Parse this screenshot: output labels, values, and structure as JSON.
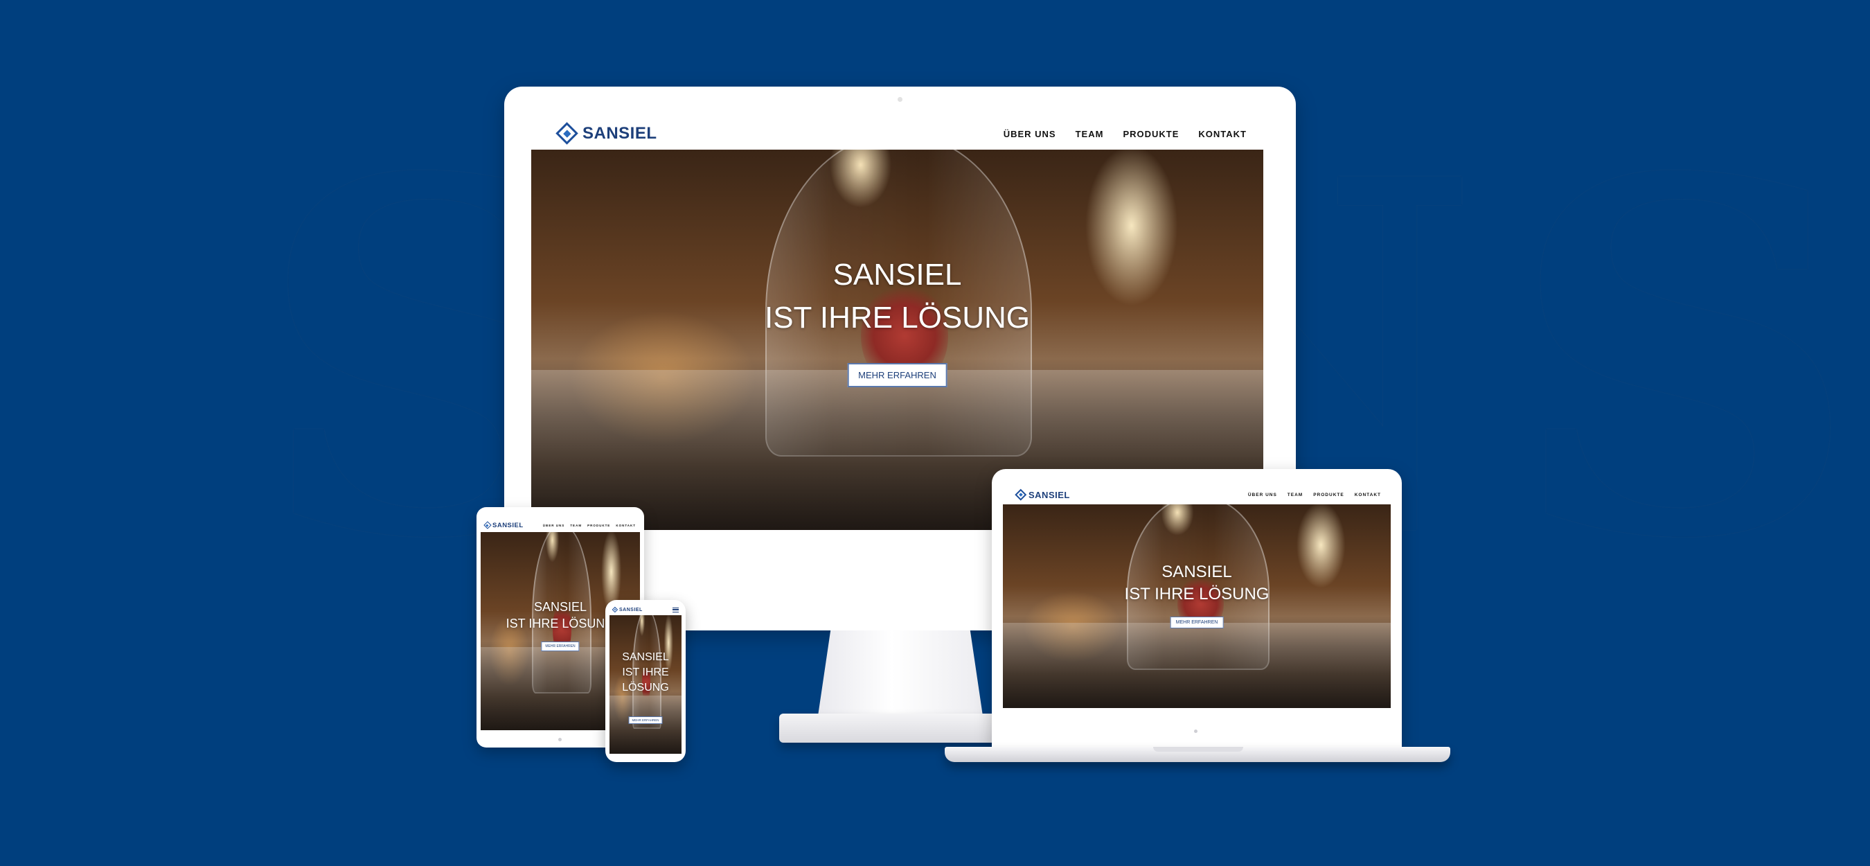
{
  "background_word": "SANSIEL",
  "site": {
    "brand": "SANSIEL",
    "nav": [
      "ÜBER UNS",
      "TEAM",
      "PRODUKTE",
      "KONTAKT"
    ],
    "hero": {
      "title_line1": "SANSIEL",
      "title_line2": "IST IHRE LÖSUNG",
      "phone_line2": "IST IHRE",
      "phone_line3": "LÖSUNG",
      "cta": "MEHR ERFAHREN"
    }
  },
  "colors": {
    "background": "#003f7e",
    "brand_blue": "#1d3f7a",
    "device_white": "#ffffff"
  }
}
